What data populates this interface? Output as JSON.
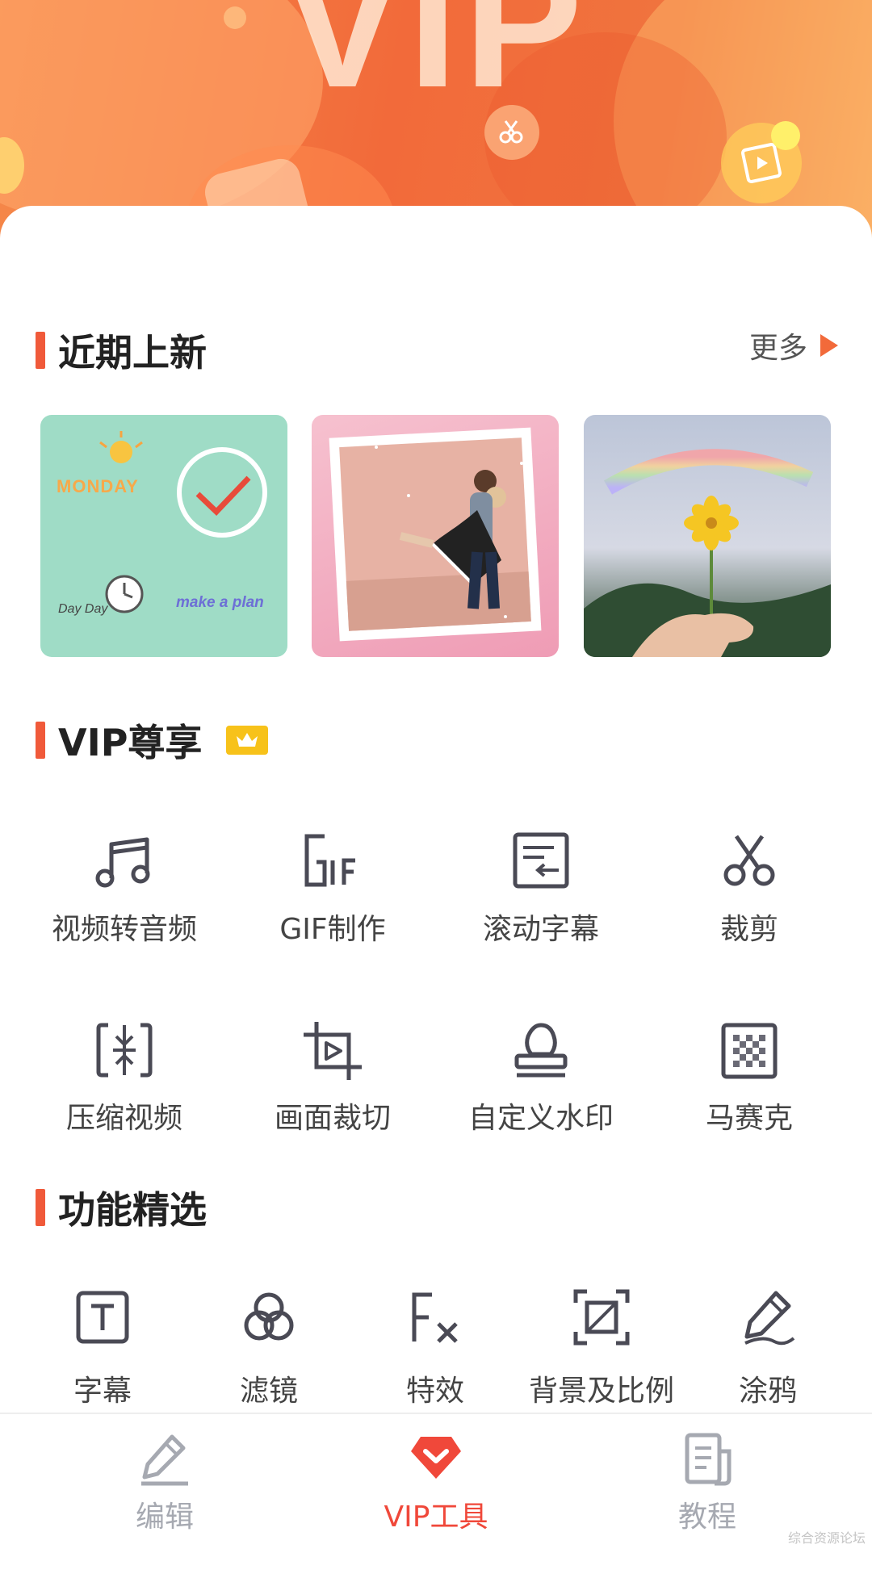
{
  "banner": {
    "title": "VIP"
  },
  "recent": {
    "title": "近期上新",
    "more_label": "更多",
    "thumbs": [
      {
        "text1": "MONDAY",
        "text2": "make a plan",
        "text3": "Day Day"
      },
      {},
      {}
    ]
  },
  "vip": {
    "title": "VIP尊享",
    "items": [
      {
        "label": "视频转音频",
        "icon": "music-note-icon"
      },
      {
        "label": "GIF制作",
        "icon": "gif-icon"
      },
      {
        "label": "滚动字幕",
        "icon": "scroll-subtitle-icon"
      },
      {
        "label": "裁剪",
        "icon": "scissors-icon"
      },
      {
        "label": "压缩视频",
        "icon": "compress-icon"
      },
      {
        "label": "画面裁切",
        "icon": "crop-frame-icon"
      },
      {
        "label": "自定义水印",
        "icon": "stamp-icon"
      },
      {
        "label": "马赛克",
        "icon": "mosaic-icon"
      }
    ]
  },
  "features": {
    "title": "功能精选",
    "items": [
      {
        "label": "字幕",
        "icon": "text-icon"
      },
      {
        "label": "滤镜",
        "icon": "filter-icon"
      },
      {
        "label": "特效",
        "icon": "fx-icon"
      },
      {
        "label": "背景及比例",
        "icon": "aspect-ratio-icon"
      },
      {
        "label": "涂鸦",
        "icon": "doodle-icon"
      }
    ]
  },
  "nav": {
    "items": [
      {
        "label": "编辑",
        "icon": "edit-pencil-icon",
        "active": false
      },
      {
        "label": "VIP工具",
        "icon": "vip-icon",
        "active": true
      },
      {
        "label": "教程",
        "icon": "tutorial-doc-icon",
        "active": false
      }
    ]
  },
  "watermark": "综合资源论坛",
  "colors": {
    "accent": "#f05a3a",
    "nav_active": "#f0483a",
    "nav_inactive": "#a6a9b1",
    "icon_gray": "#4a4a55",
    "badge": "#f7c21a"
  }
}
